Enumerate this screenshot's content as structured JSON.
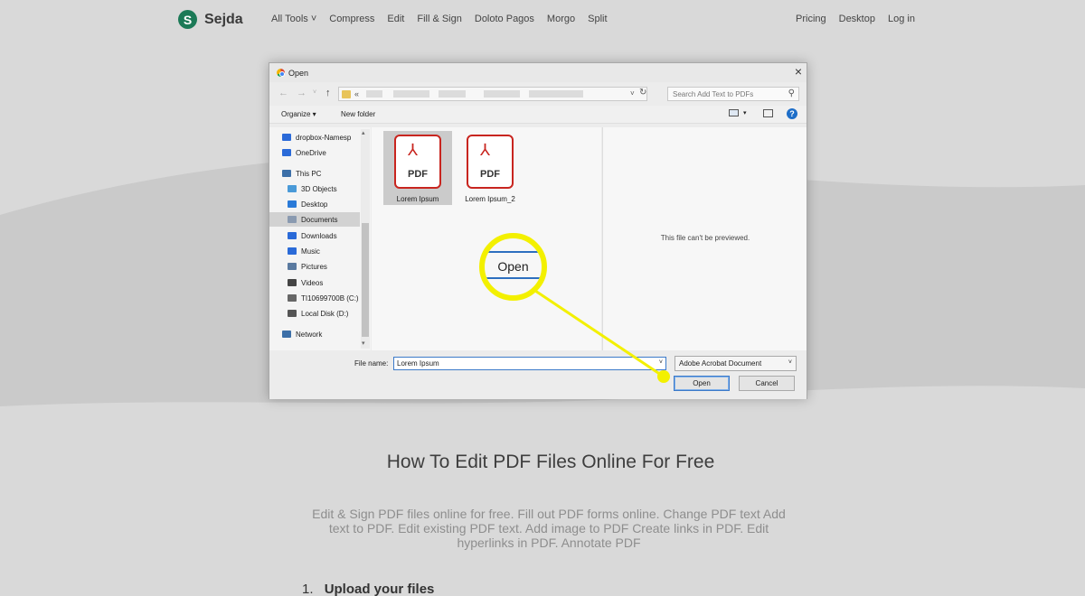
{
  "site": {
    "logo_letter": "S",
    "logo_text": "Sejda",
    "nav": [
      "All Tools ˅",
      "Compress",
      "Edit",
      "Fill & Sign",
      "Doloto Pagos",
      "Morgo",
      "Split"
    ],
    "nav_right": [
      "Pricing",
      "Desktop",
      "Log in"
    ],
    "headline": "How To Edit PDF Files Online For Free",
    "subtext": "Edit & Sign PDF files online for free. Fill out PDF forms online. Change PDF text Add text to PDF. Edit existing PDF text. Add image to PDF Create links in PDF. Edit hyperlinks in PDF. Annotate PDF",
    "step_number": "1.",
    "step_text": "Upload your files"
  },
  "dialog": {
    "title": "Open",
    "close_glyph": "×",
    "address_chevron": "«",
    "search_placeholder": "Search Add Text to PDFs",
    "toolbar": {
      "organize": "Organize ▾",
      "new_folder": "New folder",
      "help": "?"
    },
    "nav_items": [
      {
        "label": "dropbox-Namesp",
        "icon": "dropbox-icon",
        "color": "#2a6ad8"
      },
      {
        "label": "OneDrive",
        "icon": "cloud-icon",
        "color": "#2a6ad8"
      },
      {
        "label": "This PC",
        "icon": "computer-icon",
        "color": "#3c6fa8"
      },
      {
        "label": "3D Objects",
        "icon": "cube-icon",
        "color": "#4a9ad8"
      },
      {
        "label": "Desktop",
        "icon": "desktop-icon",
        "color": "#2a7ad8"
      },
      {
        "label": "Documents",
        "icon": "documents-icon",
        "color": "#8a9ab0"
      },
      {
        "label": "Downloads",
        "icon": "download-icon",
        "color": "#2a6ad8"
      },
      {
        "label": "Music",
        "icon": "music-icon",
        "color": "#2a6ad8"
      },
      {
        "label": "Pictures",
        "icon": "pictures-icon",
        "color": "#5a7aa0"
      },
      {
        "label": "Videos",
        "icon": "videos-icon",
        "color": "#444"
      },
      {
        "label": "TI10699700B (C:)",
        "icon": "drive-icon",
        "color": "#666"
      },
      {
        "label": "Local Disk (D:)",
        "icon": "disk-icon",
        "color": "#555"
      },
      {
        "label": "Network",
        "icon": "network-icon",
        "color": "#3c6fa8"
      }
    ],
    "files": [
      {
        "name": "Lorem Ipsum",
        "icon_label": "PDF",
        "selected": true
      },
      {
        "name": "Lorem Ipsum_2",
        "icon_label": "PDF",
        "selected": false
      }
    ],
    "preview_message": "This file can't be previewed.",
    "file_name_label": "File name:",
    "file_name_value": "Lorem Ipsum",
    "file_type": "Adobe Acrobat Document",
    "open_button": "Open",
    "cancel_button": "Cancel"
  },
  "callout": {
    "text": "Open",
    "color": "#f3f000"
  }
}
